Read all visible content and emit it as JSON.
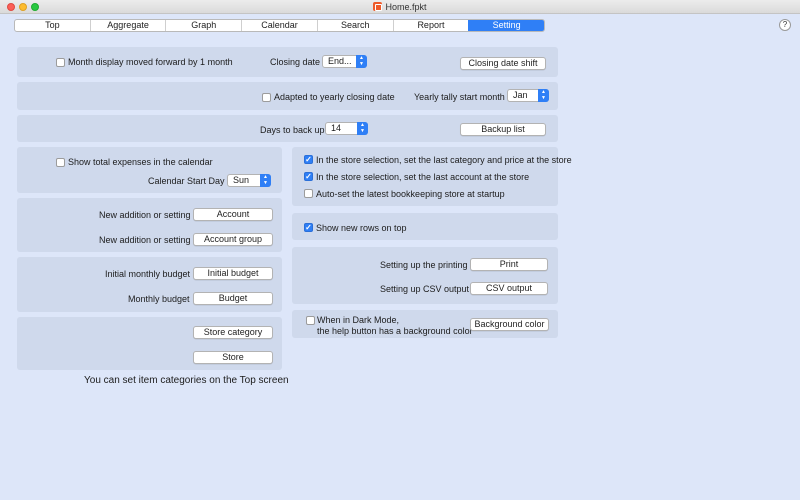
{
  "window": {
    "title": "Home.fpkt",
    "help": "?"
  },
  "tabs": [
    {
      "label": "Top"
    },
    {
      "label": "Aggregate"
    },
    {
      "label": "Graph"
    },
    {
      "label": "Calendar"
    },
    {
      "label": "Search"
    },
    {
      "label": "Report"
    },
    {
      "label": "Setting",
      "selected": true
    }
  ],
  "row1": {
    "month_forward": {
      "label": "Month display moved forward by 1 month",
      "checked": false
    },
    "closing_date_label": "Closing date",
    "closing_date_value": "End...",
    "closing_date_shift": "Closing date shift"
  },
  "row2": {
    "adapted_yearly": {
      "label": "Adapted to yearly closing date",
      "checked": false
    },
    "yearly_start_label": "Yearly tally start month",
    "yearly_start_value": "Jan"
  },
  "row3": {
    "days_backup_label": "Days to back up",
    "days_backup_value": "14",
    "backup_list": "Backup list"
  },
  "calendar_panel": {
    "show_total": {
      "label": "Show total expenses in the calendar",
      "checked": false
    },
    "start_day_label": "Calendar Start Day",
    "start_day_value": "Sun"
  },
  "store_panel": {
    "last_category": {
      "label": "In the store selection, set the last category and price at the store",
      "checked": true
    },
    "last_account": {
      "label": "In the store selection, set the last account at the store",
      "checked": true
    },
    "auto_set": {
      "label": "Auto-set the latest bookkeeping store at startup",
      "checked": false
    }
  },
  "account_panel": {
    "account_label": "New addition or setting",
    "account_btn": "Account",
    "group_label": "New addition or setting",
    "group_btn": "Account group"
  },
  "new_rows": {
    "label": "Show new rows on top",
    "checked": true
  },
  "budget_panel": {
    "initial_label": "Initial monthly budget",
    "initial_btn": "Initial budget",
    "monthly_label": "Monthly budget",
    "monthly_btn": "Budget"
  },
  "output_panel": {
    "print_label": "Setting up the printing",
    "print_btn": "Print",
    "csv_label": "Setting up CSV output",
    "csv_btn": "CSV output"
  },
  "category_panel": {
    "store_category_btn": "Store category",
    "store_btn": "Store"
  },
  "darkmode_panel": {
    "line1": "When in Dark Mode,",
    "line2": "the help button has a background color",
    "checked": false,
    "btn": "Background color"
  },
  "footnote": "You can set item categories on the Top screen",
  "colors": {
    "background": "#dde6f9",
    "panel": "#cfd9ec",
    "accent": "#2f7ff6"
  }
}
